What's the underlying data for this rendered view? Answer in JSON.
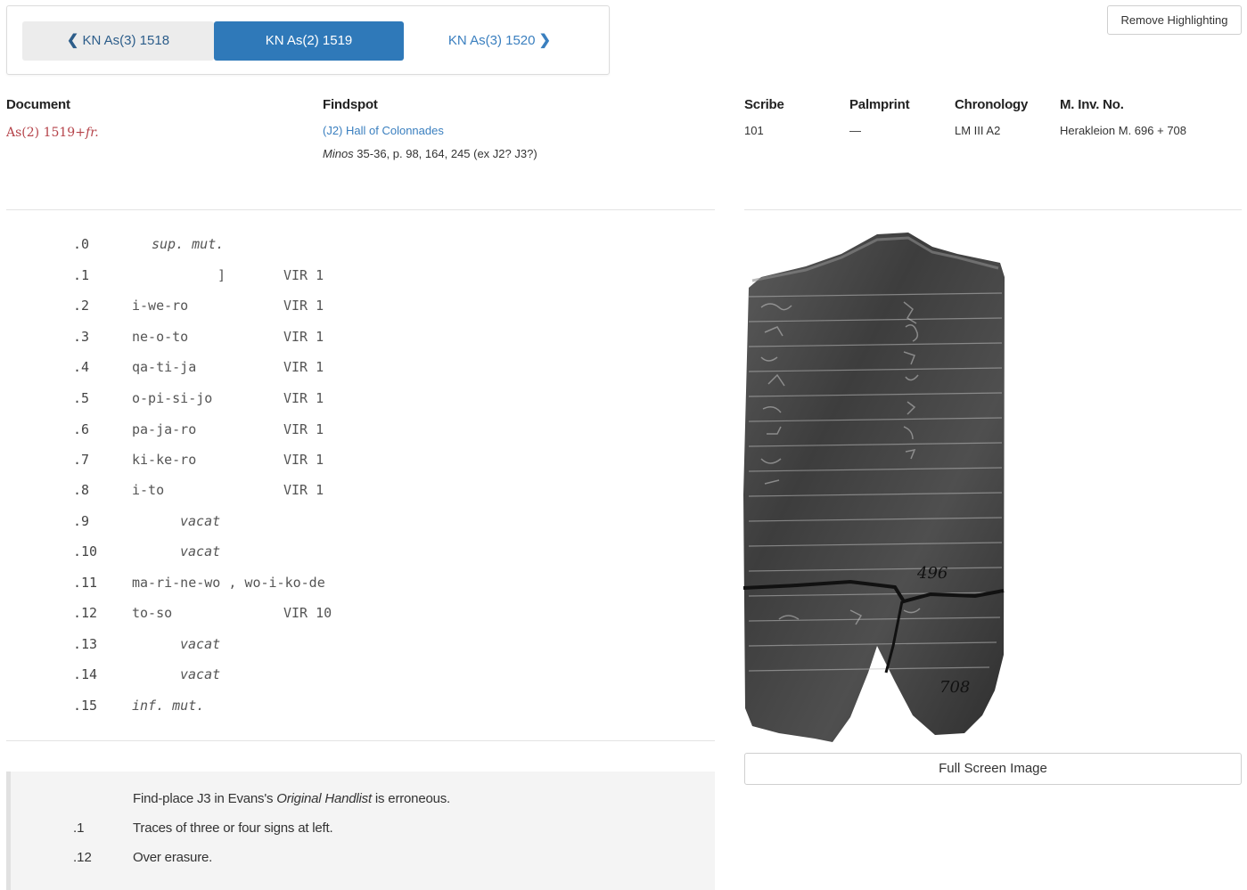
{
  "pager": {
    "prev_label": "KN As(3) 1518",
    "current_label": "KN As(2) 1519",
    "next_label": "KN As(3) 1520"
  },
  "toolbar": {
    "remove_highlighting_label": "Remove Highlighting"
  },
  "meta": {
    "document": {
      "heading": "Document",
      "value": "As(2) 1519",
      "suffix": "+fr."
    },
    "findspot": {
      "heading": "Findspot",
      "link": "(J2) Hall of Colonnades",
      "ref_title": "Minos",
      "ref_rest": " 35-36, p. 98, 164, 245 (ex J2? J3?)"
    },
    "scribe": {
      "heading": "Scribe",
      "value": "101"
    },
    "palmprint": {
      "heading": "Palmprint",
      "value": "—"
    },
    "chronology": {
      "heading": "Chronology",
      "value": "LM III A2"
    },
    "inv": {
      "heading": "M. Inv. No.",
      "value": "Herakleion M. 696 + 708"
    }
  },
  "transcription": [
    {
      "num": ".0",
      "text": "sup. mut.",
      "italic": true
    },
    {
      "num": ".1",
      "text": "]",
      "italic": false,
      "value": "VIR 1"
    },
    {
      "num": ".2",
      "text": "i-we-ro",
      "italic": false,
      "value": "VIR 1"
    },
    {
      "num": ".3",
      "text": "ne-o-to",
      "italic": false,
      "value": "VIR 1"
    },
    {
      "num": ".4",
      "text": "qa-ti-ja",
      "italic": false,
      "value": "VIR 1"
    },
    {
      "num": ".5",
      "text": "o-pi-si-jo",
      "italic": false,
      "value": "VIR 1"
    },
    {
      "num": ".6",
      "text": "pa-ja-ro",
      "italic": false,
      "value": "VIR 1"
    },
    {
      "num": ".7",
      "text": "ki-ke-ro",
      "italic": false,
      "value": "VIR 1"
    },
    {
      "num": ".8",
      "text": "i-to",
      "italic": false,
      "value": "VIR 1"
    },
    {
      "num": ".9",
      "text": "vacat",
      "italic": true
    },
    {
      "num": ".10",
      "text": "vacat",
      "italic": true
    },
    {
      "num": ".11",
      "text": "ma-ri-ne-wo , wo-i-ko-de",
      "italic": false
    },
    {
      "num": ".12",
      "text": "to-so",
      "italic": false,
      "value": "VIR 10"
    },
    {
      "num": ".13",
      "text": "vacat",
      "italic": true
    },
    {
      "num": ".14",
      "text": "vacat",
      "italic": true
    },
    {
      "num": ".15",
      "text": "inf. mut.",
      "italic": true
    }
  ],
  "image": {
    "fullscreen_label": "Full Screen Image",
    "inscriptions": [
      "496",
      "708"
    ]
  },
  "notes": {
    "general_pre": "Find-place J3 in Evans's ",
    "general_em": "Original Handlist",
    "general_post": " is erroneous.",
    "items": [
      {
        "num": ".1",
        "text": "Traces of three or four signs at left."
      },
      {
        "num": ".12",
        "text": "Over erasure."
      }
    ]
  },
  "colors": {
    "accent": "#2f79b9",
    "link": "#3a7fbf",
    "document": "#b5434a"
  }
}
